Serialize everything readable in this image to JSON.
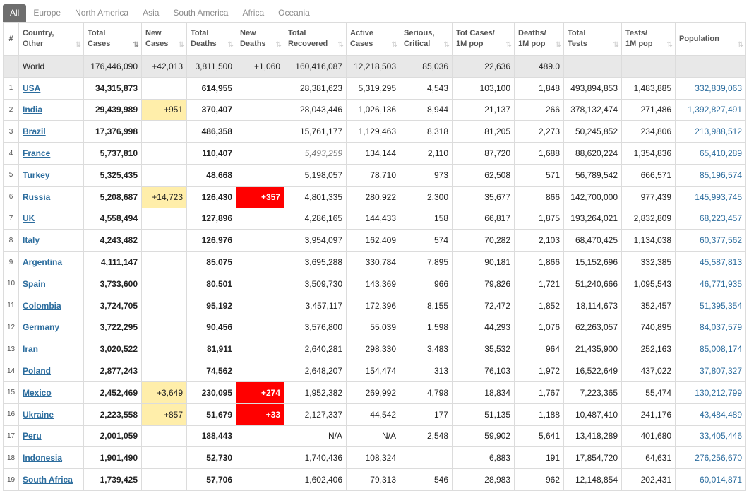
{
  "tabs": [
    {
      "label": "All",
      "active": true
    },
    {
      "label": "Europe",
      "active": false
    },
    {
      "label": "North America",
      "active": false
    },
    {
      "label": "Asia",
      "active": false
    },
    {
      "label": "South America",
      "active": false
    },
    {
      "label": "Africa",
      "active": false
    },
    {
      "label": "Oceania",
      "active": false
    }
  ],
  "columns": [
    {
      "key": "idx",
      "line1": "#",
      "line2": ""
    },
    {
      "key": "country",
      "line1": "Country,",
      "line2": "Other"
    },
    {
      "key": "total_cases",
      "line1": "Total",
      "line2": "Cases"
    },
    {
      "key": "new_cases",
      "line1": "New",
      "line2": "Cases"
    },
    {
      "key": "total_deaths",
      "line1": "Total",
      "line2": "Deaths"
    },
    {
      "key": "new_deaths",
      "line1": "New",
      "line2": "Deaths"
    },
    {
      "key": "total_recovered",
      "line1": "Total",
      "line2": "Recovered"
    },
    {
      "key": "active_cases",
      "line1": "Active",
      "line2": "Cases"
    },
    {
      "key": "serious_critical",
      "line1": "Serious,",
      "line2": "Critical"
    },
    {
      "key": "tot_cases_1m",
      "line1": "Tot Cases/",
      "line2": "1M pop"
    },
    {
      "key": "deaths_1m",
      "line1": "Deaths/",
      "line2": "1M pop"
    },
    {
      "key": "total_tests",
      "line1": "Total",
      "line2": "Tests"
    },
    {
      "key": "tests_1m",
      "line1": "Tests/",
      "line2": "1M pop"
    },
    {
      "key": "population",
      "line1": "Population",
      "line2": ""
    }
  ],
  "sort_icon": "⇅",
  "sorted_column": "total_cases",
  "highlight_colors": {
    "new_cases": "#ffeeaa",
    "new_deaths": "#ff0000",
    "link": "#2c6d9e",
    "world_row": "#e8e8e8"
  },
  "world": {
    "country": "World",
    "total_cases": "176,446,090",
    "new_cases": "+42,013",
    "total_deaths": "3,811,500",
    "new_deaths": "+1,060",
    "total_recovered": "160,416,087",
    "active_cases": "12,218,503",
    "serious_critical": "85,036",
    "tot_cases_1m": "22,636",
    "deaths_1m": "489.0",
    "total_tests": "",
    "tests_1m": "",
    "population": ""
  },
  "rows": [
    {
      "idx": "1",
      "country": "USA",
      "total_cases": "34,315,873",
      "new_cases": "",
      "total_deaths": "614,955",
      "new_deaths": "",
      "total_recovered": "28,381,623",
      "active_cases": "5,319,295",
      "serious_critical": "4,543",
      "tot_cases_1m": "103,100",
      "deaths_1m": "1,848",
      "total_tests": "493,894,853",
      "tests_1m": "1,483,885",
      "population": "332,839,063"
    },
    {
      "idx": "2",
      "country": "India",
      "total_cases": "29,439,989",
      "new_cases": "+951",
      "total_deaths": "370,407",
      "new_deaths": "",
      "total_recovered": "28,043,446",
      "active_cases": "1,026,136",
      "serious_critical": "8,944",
      "tot_cases_1m": "21,137",
      "deaths_1m": "266",
      "total_tests": "378,132,474",
      "tests_1m": "271,486",
      "population": "1,392,827,491"
    },
    {
      "idx": "3",
      "country": "Brazil",
      "total_cases": "17,376,998",
      "new_cases": "",
      "total_deaths": "486,358",
      "new_deaths": "",
      "total_recovered": "15,761,177",
      "active_cases": "1,129,463",
      "serious_critical": "8,318",
      "tot_cases_1m": "81,205",
      "deaths_1m": "2,273",
      "total_tests": "50,245,852",
      "tests_1m": "234,806",
      "population": "213,988,512"
    },
    {
      "idx": "4",
      "country": "France",
      "total_cases": "5,737,810",
      "new_cases": "",
      "total_deaths": "110,407",
      "new_deaths": "",
      "total_recovered": "5,493,259",
      "recovered_italic": true,
      "active_cases": "134,144",
      "serious_critical": "2,110",
      "tot_cases_1m": "87,720",
      "deaths_1m": "1,688",
      "total_tests": "88,620,224",
      "tests_1m": "1,354,836",
      "population": "65,410,289"
    },
    {
      "idx": "5",
      "country": "Turkey",
      "total_cases": "5,325,435",
      "new_cases": "",
      "total_deaths": "48,668",
      "new_deaths": "",
      "total_recovered": "5,198,057",
      "active_cases": "78,710",
      "serious_critical": "973",
      "tot_cases_1m": "62,508",
      "deaths_1m": "571",
      "total_tests": "56,789,542",
      "tests_1m": "666,571",
      "population": "85,196,574"
    },
    {
      "idx": "6",
      "country": "Russia",
      "total_cases": "5,208,687",
      "new_cases": "+14,723",
      "total_deaths": "126,430",
      "new_deaths": "+357",
      "total_recovered": "4,801,335",
      "active_cases": "280,922",
      "serious_critical": "2,300",
      "tot_cases_1m": "35,677",
      "deaths_1m": "866",
      "total_tests": "142,700,000",
      "tests_1m": "977,439",
      "population": "145,993,745"
    },
    {
      "idx": "7",
      "country": "UK",
      "total_cases": "4,558,494",
      "new_cases": "",
      "total_deaths": "127,896",
      "new_deaths": "",
      "total_recovered": "4,286,165",
      "active_cases": "144,433",
      "serious_critical": "158",
      "tot_cases_1m": "66,817",
      "deaths_1m": "1,875",
      "total_tests": "193,264,021",
      "tests_1m": "2,832,809",
      "population": "68,223,457"
    },
    {
      "idx": "8",
      "country": "Italy",
      "total_cases": "4,243,482",
      "new_cases": "",
      "total_deaths": "126,976",
      "new_deaths": "",
      "total_recovered": "3,954,097",
      "active_cases": "162,409",
      "serious_critical": "574",
      "tot_cases_1m": "70,282",
      "deaths_1m": "2,103",
      "total_tests": "68,470,425",
      "tests_1m": "1,134,038",
      "population": "60,377,562"
    },
    {
      "idx": "9",
      "country": "Argentina",
      "total_cases": "4,111,147",
      "new_cases": "",
      "total_deaths": "85,075",
      "new_deaths": "",
      "total_recovered": "3,695,288",
      "active_cases": "330,784",
      "serious_critical": "7,895",
      "tot_cases_1m": "90,181",
      "deaths_1m": "1,866",
      "total_tests": "15,152,696",
      "tests_1m": "332,385",
      "population": "45,587,813"
    },
    {
      "idx": "10",
      "country": "Spain",
      "total_cases": "3,733,600",
      "new_cases": "",
      "total_deaths": "80,501",
      "new_deaths": "",
      "total_recovered": "3,509,730",
      "active_cases": "143,369",
      "serious_critical": "966",
      "tot_cases_1m": "79,826",
      "deaths_1m": "1,721",
      "total_tests": "51,240,666",
      "tests_1m": "1,095,543",
      "population": "46,771,935"
    },
    {
      "idx": "11",
      "country": "Colombia",
      "total_cases": "3,724,705",
      "new_cases": "",
      "total_deaths": "95,192",
      "new_deaths": "",
      "total_recovered": "3,457,117",
      "active_cases": "172,396",
      "serious_critical": "8,155",
      "tot_cases_1m": "72,472",
      "deaths_1m": "1,852",
      "total_tests": "18,114,673",
      "tests_1m": "352,457",
      "population": "51,395,354"
    },
    {
      "idx": "12",
      "country": "Germany",
      "total_cases": "3,722,295",
      "new_cases": "",
      "total_deaths": "90,456",
      "new_deaths": "",
      "total_recovered": "3,576,800",
      "active_cases": "55,039",
      "serious_critical": "1,598",
      "tot_cases_1m": "44,293",
      "deaths_1m": "1,076",
      "total_tests": "62,263,057",
      "tests_1m": "740,895",
      "population": "84,037,579"
    },
    {
      "idx": "13",
      "country": "Iran",
      "total_cases": "3,020,522",
      "new_cases": "",
      "total_deaths": "81,911",
      "new_deaths": "",
      "total_recovered": "2,640,281",
      "active_cases": "298,330",
      "serious_critical": "3,483",
      "tot_cases_1m": "35,532",
      "deaths_1m": "964",
      "total_tests": "21,435,900",
      "tests_1m": "252,163",
      "population": "85,008,174"
    },
    {
      "idx": "14",
      "country": "Poland",
      "total_cases": "2,877,243",
      "new_cases": "",
      "total_deaths": "74,562",
      "new_deaths": "",
      "total_recovered": "2,648,207",
      "active_cases": "154,474",
      "serious_critical": "313",
      "tot_cases_1m": "76,103",
      "deaths_1m": "1,972",
      "total_tests": "16,522,649",
      "tests_1m": "437,022",
      "population": "37,807,327"
    },
    {
      "idx": "15",
      "country": "Mexico",
      "total_cases": "2,452,469",
      "new_cases": "+3,649",
      "total_deaths": "230,095",
      "new_deaths": "+274",
      "total_recovered": "1,952,382",
      "active_cases": "269,992",
      "serious_critical": "4,798",
      "tot_cases_1m": "18,834",
      "deaths_1m": "1,767",
      "total_tests": "7,223,365",
      "tests_1m": "55,474",
      "population": "130,212,799"
    },
    {
      "idx": "16",
      "country": "Ukraine",
      "total_cases": "2,223,558",
      "new_cases": "+857",
      "total_deaths": "51,679",
      "new_deaths": "+33",
      "total_recovered": "2,127,337",
      "active_cases": "44,542",
      "serious_critical": "177",
      "tot_cases_1m": "51,135",
      "deaths_1m": "1,188",
      "total_tests": "10,487,410",
      "tests_1m": "241,176",
      "population": "43,484,489"
    },
    {
      "idx": "17",
      "country": "Peru",
      "total_cases": "2,001,059",
      "new_cases": "",
      "total_deaths": "188,443",
      "new_deaths": "",
      "total_recovered": "N/A",
      "active_cases": "N/A",
      "serious_critical": "2,548",
      "tot_cases_1m": "59,902",
      "deaths_1m": "5,641",
      "total_tests": "13,418,289",
      "tests_1m": "401,680",
      "population": "33,405,446"
    },
    {
      "idx": "18",
      "country": "Indonesia",
      "total_cases": "1,901,490",
      "new_cases": "",
      "total_deaths": "52,730",
      "new_deaths": "",
      "total_recovered": "1,740,436",
      "active_cases": "108,324",
      "serious_critical": "",
      "tot_cases_1m": "6,883",
      "deaths_1m": "191",
      "total_tests": "17,854,720",
      "tests_1m": "64,631",
      "population": "276,256,670"
    },
    {
      "idx": "19",
      "country": "South Africa",
      "total_cases": "1,739,425",
      "new_cases": "",
      "total_deaths": "57,706",
      "new_deaths": "",
      "total_recovered": "1,602,406",
      "active_cases": "79,313",
      "serious_critical": "546",
      "tot_cases_1m": "28,983",
      "deaths_1m": "962",
      "total_tests": "12,148,854",
      "tests_1m": "202,431",
      "population": "60,014,871"
    }
  ]
}
